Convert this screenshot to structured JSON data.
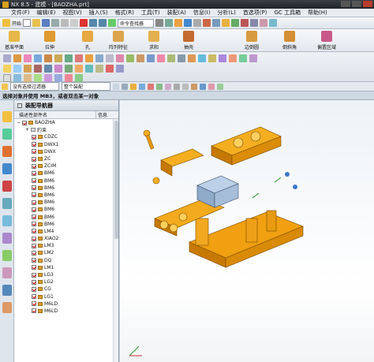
{
  "window": {
    "title": "NX 8.5 - 建模 - [BAOZHA.prt]"
  },
  "menu": [
    "文件(F)",
    "编辑(E)",
    "视图(V)",
    "插入(S)",
    "格式(R)",
    "工具(T)",
    "装配(A)",
    "信息(I)",
    "分析(L)",
    "首选项(P)",
    "GC 工具箱",
    "帮助(H)"
  ],
  "toolbar": {
    "command_finder_label": "命令查找器",
    "start_label": "开始"
  },
  "ribbon": {
    "buttons": [
      "基准平面",
      "拉伸",
      "孔",
      "阵列特征",
      "求和",
      "抽壳",
      "边倒圆",
      "倒斜角",
      "偏置区域"
    ]
  },
  "selection": {
    "filter": "没有选择过滤器",
    "scope": "整个装配"
  },
  "cue": "选择对象并使用 MB3，或者双击某一对象",
  "navigator": {
    "title": "装配导航器",
    "col_name": "描述性部件名",
    "col_info": "信息",
    "root": "BAOZHA",
    "constraints": "约束",
    "parts": [
      "CDZC",
      "DWX1",
      "DWX",
      "ZC",
      "ZCIM",
      "BM6",
      "BM6",
      "BM6",
      "BM6",
      "BM6",
      "BM6",
      "BM6",
      "BM6",
      "LM4",
      "XIAO2",
      "LM3",
      "LM2",
      "DQ",
      "LM1",
      "LG3",
      "LG2",
      "CG",
      "LG1",
      "M6LD",
      "M6LD"
    ]
  },
  "colors": {
    "part_orange": "#f0a010",
    "part_dark": "#b86e00",
    "block_blue": "#9bb6d6",
    "viewport_bg": "#f6f8fa",
    "cue_bar": "#cfd8e3"
  }
}
